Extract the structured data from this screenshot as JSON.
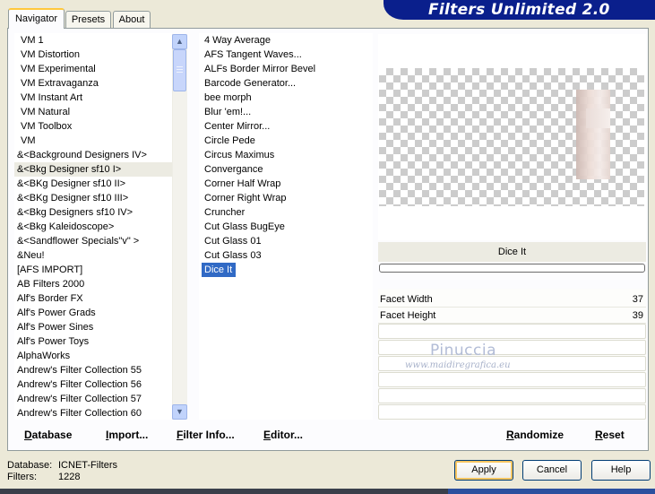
{
  "app_title": "Filters Unlimited 2.0",
  "tabs": [
    {
      "label": "Navigator",
      "active": true
    },
    {
      "label": "Presets",
      "active": false
    },
    {
      "label": "About",
      "active": false
    }
  ],
  "categories": [
    "VM 1",
    "VM Distortion",
    "VM Experimental",
    "VM Extravaganza",
    "VM Instant Art",
    "VM Natural",
    "VM Toolbox",
    "VM",
    "&<Background Designers IV>",
    "&<Bkg Designer sf10 I>",
    "&<BKg Designer sf10 II>",
    "&<BKg Designer sf10 III>",
    "&<Bkg Designers sf10 IV>",
    "&<Bkg Kaleidoscope>",
    "&<Sandflower Specials\"v\" >",
    "&Neu!",
    "[AFS IMPORT]",
    "AB Filters 2000",
    "Alf's Border FX",
    "Alf's Power Grads",
    "Alf's Power Sines",
    "Alf's Power Toys",
    "AlphaWorks",
    "Andrew's Filter Collection 55",
    "Andrew's Filter Collection 56",
    "Andrew's Filter Collection 57",
    "Andrew's Filter Collection 60"
  ],
  "selected_category": "&<Bkg Designer sf10 I>",
  "filters": [
    "4 Way Average",
    "AFS Tangent Waves...",
    "ALFs Border Mirror Bevel",
    "Barcode Generator...",
    "bee morph",
    "Blur 'em!...",
    "Center Mirror...",
    "Circle Pede",
    "Circus Maximus",
    "Convergance",
    "Corner Half Wrap",
    "Corner Right Wrap",
    "Cruncher",
    "Cut Glass  BugEye",
    "Cut Glass 01",
    "Cut Glass 03",
    "Dice It"
  ],
  "selected_filter": "Dice It",
  "preview": {
    "filter_name": "Dice It"
  },
  "params": [
    {
      "label": "Facet Width",
      "value": "37"
    },
    {
      "label": "Facet Height",
      "value": "39"
    }
  ],
  "watermark": {
    "name": "Pinuccia",
    "url": "www.maidiregrafica.eu"
  },
  "toolbar": {
    "database": "Database",
    "import": "Import...",
    "filter_info": "Filter Info...",
    "editor": "Editor...",
    "randomize": "Randomize",
    "reset": "Reset"
  },
  "footer": {
    "database_label": "Database:",
    "database_value": "ICNET-Filters",
    "filters_label": "Filters:",
    "filters_value": "1228"
  },
  "buttons": {
    "apply": "Apply",
    "cancel": "Cancel",
    "help": "Help"
  },
  "colors": {
    "banner": "#0a1f8c",
    "selection": "#316ac5",
    "dialog_bg": "#ece9d8"
  }
}
